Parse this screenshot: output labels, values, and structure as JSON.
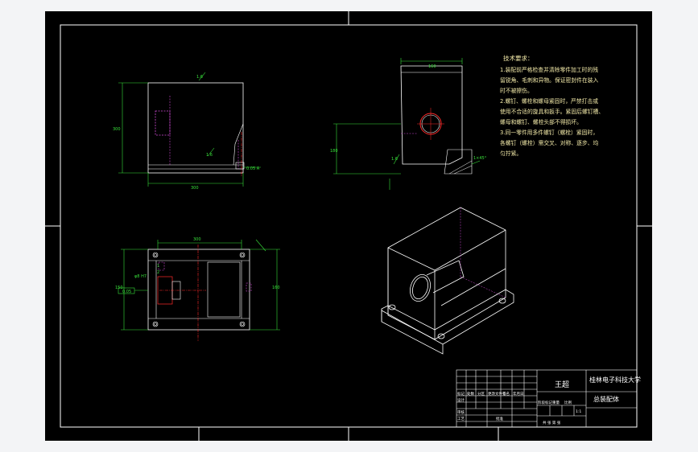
{
  "colors": {
    "background": "#000000",
    "outline": "#ffffff",
    "dimension": "#38e03a",
    "hidden": "#d14bd6",
    "centerline": "#ff2a2a",
    "text": "#f2e9a8",
    "page": "#f3f4f6"
  },
  "technical_requirements": {
    "title": "技术要求：",
    "lines": [
      "1.装配前严格检查并清除零件加工时的残",
      "留锐角、毛刺和异物。保证密封件在装入",
      "时不被擦伤。",
      "2.螺钉、螺栓和螺母紧固时，严禁打击或",
      "使用不合适的旋具和扳手。紧固后螺钉槽、",
      "螺母和螺钉、螺栓头部不得损坏。",
      "3.同一零件用多件螺钉（螺栓）紧固时，",
      "各螺钉（螺栓）需交叉、对称、逐步、均",
      "匀拧紧。"
    ]
  },
  "dimensions": {
    "front_width": "300",
    "front_height": "300",
    "side_width": "160",
    "side_height": "180",
    "top_width": "300",
    "top_depth": "160",
    "top_side": "150",
    "side_base": "40"
  },
  "surface_marks": {
    "front_top": "1.6",
    "front_mid": "1.6",
    "side_mid": "1.6"
  },
  "annotations": {
    "tolerance": "0.05 A",
    "datum": "A",
    "chamfer": "1×45°",
    "part_ref_1": "1",
    "part_ref_2": "2",
    "flat": "0.05",
    "fit": "φ8 H7"
  },
  "title_block": {
    "designer": "王超",
    "school": "桂林电子科技大学",
    "drawing_name": "总装配体",
    "header_cells": [
      "标记",
      "处数",
      "分区",
      "更改文件号",
      "签名",
      "年月日"
    ],
    "row_labels": [
      "设计",
      "审核",
      "工艺"
    ],
    "approve": "批准",
    "stage": "阶段标记",
    "weight": "重量",
    "scale": "比例",
    "scale_value": "1:1",
    "sheet": "共 张 第 张"
  }
}
